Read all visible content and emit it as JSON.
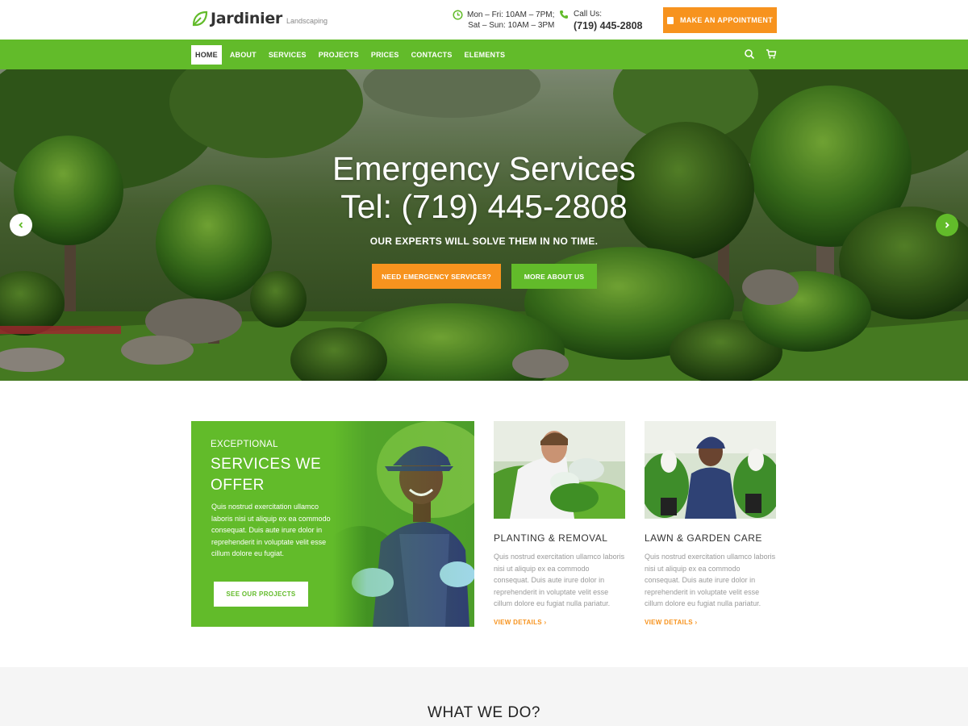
{
  "header": {
    "logo_name": "Jardinier",
    "logo_tagline": "Landscaping",
    "hours_line1": "Mon – Fri: 10AM – 7PM;",
    "hours_line2": "Sat – Sun: 10AM – 3PM",
    "call_label": "Call Us:",
    "call_number": "(719) 445-2808",
    "appointment_label": "MAKE AN APPOINTMENT"
  },
  "nav": {
    "items": [
      {
        "label": "HOME"
      },
      {
        "label": "ABOUT"
      },
      {
        "label": "SERVICES"
      },
      {
        "label": "PROJECTS"
      },
      {
        "label": "PRICES"
      },
      {
        "label": "CONTACTS"
      },
      {
        "label": "ELEMENTS"
      }
    ],
    "active_index": 0,
    "icons": [
      "search-icon",
      "cart-icon"
    ]
  },
  "hero": {
    "title_line1": "Emergency Services",
    "title_line2": "Tel: (719) 445-2808",
    "subtitle": "OUR EXPERTS WILL SOLVE THEM IN NO TIME.",
    "primary_button": "NEED EMERGENCY SERVICES?",
    "secondary_button": "MORE ABOUT US",
    "prev_icon": "chevron-left-icon",
    "next_icon": "chevron-right-icon"
  },
  "promo": {
    "kicker": "EXCEPTIONAL",
    "heading": "SERVICES WE OFFER",
    "body": "Quis nostrud exercitation ullamco laboris nisi ut aliquip ex ea commodo consequat. Duis aute irure dolor in reprehenderit in voluptate velit esse cillum dolore eu fugiat.",
    "button": "SEE OUR PROJECTS"
  },
  "services": [
    {
      "title": "PLANTING & REMOVAL",
      "desc": "Quis nostrud exercitation ullamco laboris nisi ut aliquip ex ea commodo consequat. Duis aute irure dolor in reprehenderit in voluptate velit esse cillum dolore eu fugiat nulla pariatur.",
      "link": "VIEW DETAILS"
    },
    {
      "title": "LAWN & GARDEN CARE",
      "desc": "Quis nostrud exercitation ullamco laboris nisi ut aliquip ex ea commodo consequat. Duis aute irure dolor in reprehenderit in voluptate velit esse cillum dolore eu fugiat nulla pariatur.",
      "link": "VIEW DETAILS"
    }
  ],
  "section": {
    "what_we_do": "WHAT WE DO?"
  },
  "colors": {
    "brand_green": "#62bb2a",
    "accent_orange": "#f7931e"
  }
}
